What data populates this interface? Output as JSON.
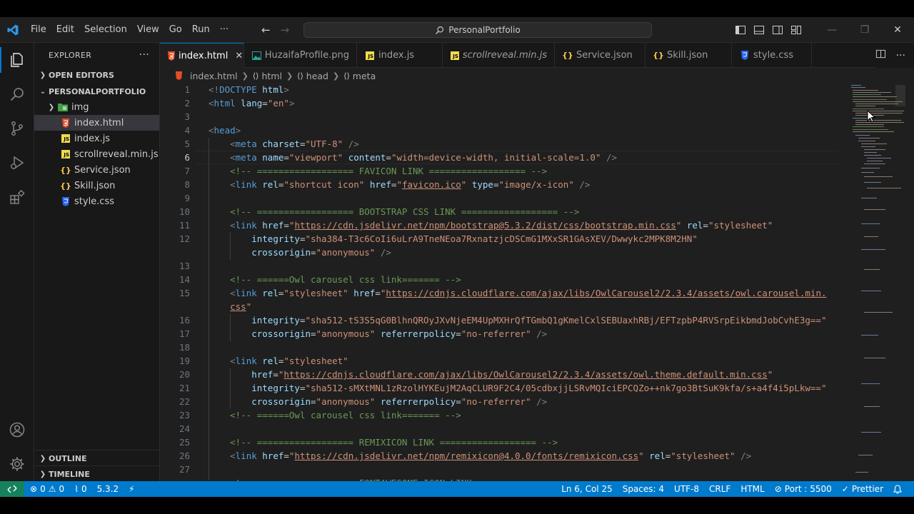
{
  "titlebar": {
    "menu": [
      "File",
      "Edit",
      "Selection",
      "View",
      "Go",
      "Run",
      "···"
    ],
    "search_text": "PersonalPortfolio"
  },
  "sidebar": {
    "title": "EXPLORER",
    "more": "···",
    "open_editors": "OPEN EDITORS",
    "project": "PERSONALPORTFOLIO",
    "items": [
      {
        "label": "img",
        "type": "folder"
      },
      {
        "label": "index.html",
        "type": "html"
      },
      {
        "label": "index.js",
        "type": "js"
      },
      {
        "label": "scrollreveal.min.js",
        "type": "js"
      },
      {
        "label": "Service.json",
        "type": "json"
      },
      {
        "label": "Skill.json",
        "type": "json"
      },
      {
        "label": "style.css",
        "type": "css"
      }
    ],
    "outline": "OUTLINE",
    "timeline": "TIMELINE"
  },
  "tabs": [
    {
      "label": "index.html",
      "type": "html",
      "active": true
    },
    {
      "label": "HuzaifaProfile.png",
      "type": "png"
    },
    {
      "label": "index.js",
      "type": "js"
    },
    {
      "label": "scrollreveal.min.js",
      "type": "js",
      "italic": true
    },
    {
      "label": "Service.json",
      "type": "json"
    },
    {
      "label": "Skill.json",
      "type": "json"
    },
    {
      "label": "style.css",
      "type": "css"
    }
  ],
  "breadcrumb": [
    "index.html",
    "html",
    "head",
    "meta"
  ],
  "editor": {
    "active_line": 6,
    "line_numbers": [
      "1",
      "2",
      "3",
      "4",
      "5",
      "6",
      "7",
      "8",
      "9",
      "10",
      "11",
      "12",
      "",
      "13",
      "14",
      "15",
      "",
      "16",
      "17",
      "18",
      "19",
      "20",
      "21",
      "22",
      "23",
      "24",
      "25",
      "26",
      "27"
    ]
  },
  "statusbar": {
    "errors": "0",
    "warnings": "0",
    "ports": "0",
    "version": "5.3.2",
    "position": "Ln 6, Col 25",
    "spaces": "Spaces: 4",
    "encoding": "UTF-8",
    "eol": "CRLF",
    "language": "HTML",
    "port": "Port : 5500",
    "formatter": "Prettier"
  },
  "colors": {
    "accent": "#0078d4",
    "statusbar": "#007acc",
    "remote": "#16825d",
    "tag": "#569cd6",
    "attr": "#9cdcfe",
    "string": "#ce9178",
    "comment": "#6a9955"
  }
}
